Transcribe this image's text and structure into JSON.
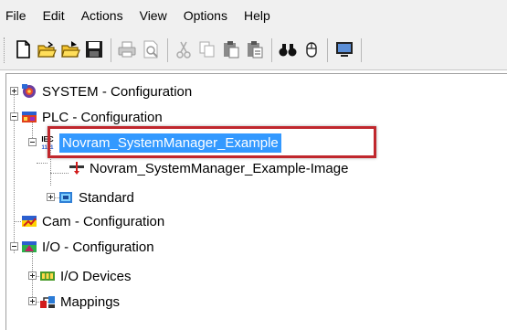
{
  "menu": {
    "items": [
      "File",
      "Edit",
      "Actions",
      "View",
      "Options",
      "Help"
    ]
  },
  "toolbar": {
    "icons": [
      "new-file-icon",
      "open-folder-icon",
      "open-project-icon",
      "save-icon",
      "print-icon",
      "print-preview-icon",
      "cut-icon",
      "copy-icon",
      "paste-icon",
      "paste-with-links-icon",
      "find-icon",
      "mouse-icon",
      "monitor-icon"
    ]
  },
  "tree": {
    "system": {
      "label": "SYSTEM - Configuration"
    },
    "plc": {
      "label": "PLC - Configuration"
    },
    "plc_project": {
      "label": "Novram_SystemManager_Example",
      "icon_text_top": "IEC",
      "icon_text_bottom": "1131"
    },
    "plc_image": {
      "label": "Novram_SystemManager_Example-Image"
    },
    "standard": {
      "label": "Standard"
    },
    "cam": {
      "label": "Cam - Configuration"
    },
    "io": {
      "label": "I/O - Configuration"
    },
    "io_devices": {
      "label": "I/O Devices"
    },
    "mappings": {
      "label": "Mappings"
    }
  },
  "colors": {
    "selection": "#3399ff",
    "highlight_border": "#c0272d"
  }
}
